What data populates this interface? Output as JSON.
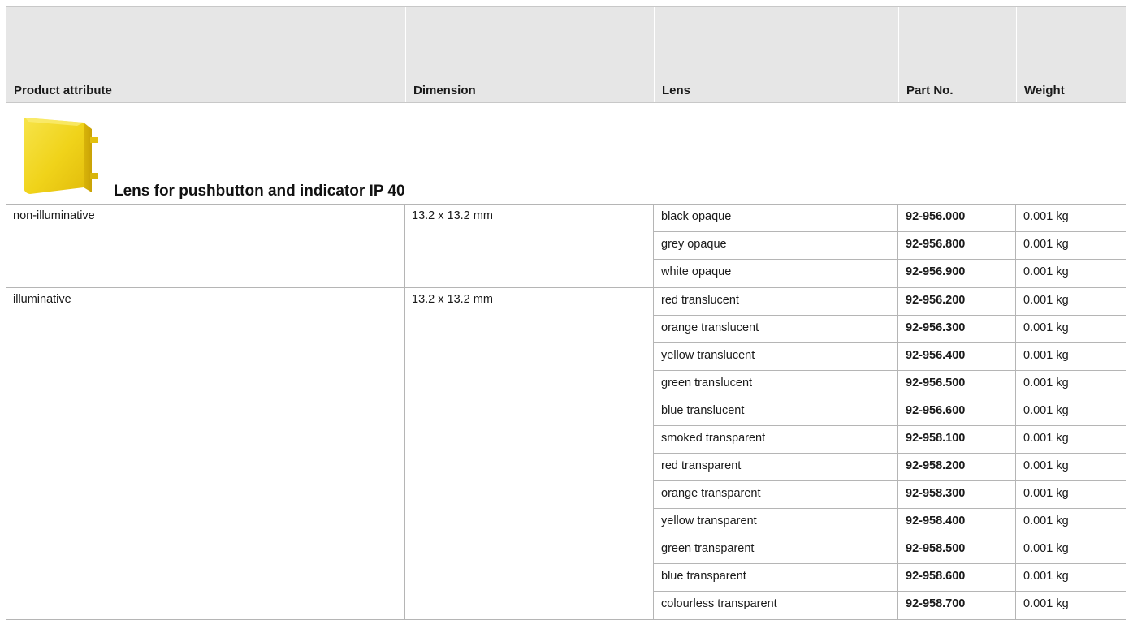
{
  "header": {
    "product_attribute": "Product attribute",
    "dimension": "Dimension",
    "lens": "Lens",
    "part_no": "Part No.",
    "weight": "Weight"
  },
  "product": {
    "title": "Lens for pushbutton and indicator IP 40",
    "image_icon": "yellow-lens-icon",
    "image_color": "#f2d51f"
  },
  "groups": [
    {
      "attribute": "non-illuminative",
      "dimension": "13.2 x 13.2 mm",
      "rows": [
        {
          "lens": "black opaque",
          "part_no": "92-956.000",
          "weight": "0.001 kg"
        },
        {
          "lens": "grey opaque",
          "part_no": "92-956.800",
          "weight": "0.001 kg"
        },
        {
          "lens": "white opaque",
          "part_no": "92-956.900",
          "weight": "0.001 kg"
        }
      ]
    },
    {
      "attribute": "illuminative",
      "dimension": "13.2 x 13.2 mm",
      "rows": [
        {
          "lens": "red translucent",
          "part_no": "92-956.200",
          "weight": "0.001 kg"
        },
        {
          "lens": "orange translucent",
          "part_no": "92-956.300",
          "weight": "0.001 kg"
        },
        {
          "lens": "yellow translucent",
          "part_no": "92-956.400",
          "weight": "0.001 kg"
        },
        {
          "lens": "green translucent",
          "part_no": "92-956.500",
          "weight": "0.001 kg"
        },
        {
          "lens": "blue translucent",
          "part_no": "92-956.600",
          "weight": "0.001 kg"
        },
        {
          "lens": "smoked transparent",
          "part_no": "92-958.100",
          "weight": "0.001 kg"
        },
        {
          "lens": "red transparent",
          "part_no": "92-958.200",
          "weight": "0.001 kg"
        },
        {
          "lens": "orange transparent",
          "part_no": "92-958.300",
          "weight": "0.001 kg"
        },
        {
          "lens": "yellow transparent",
          "part_no": "92-958.400",
          "weight": "0.001 kg"
        },
        {
          "lens": "green transparent",
          "part_no": "92-958.500",
          "weight": "0.001 kg"
        },
        {
          "lens": "blue transparent",
          "part_no": "92-958.600",
          "weight": "0.001 kg"
        },
        {
          "lens": "colourless transparent",
          "part_no": "92-958.700",
          "weight": "0.001 kg"
        }
      ]
    }
  ],
  "colors": {
    "header_bg": "#e6e6e6",
    "grid_line": "#b5b5b5"
  }
}
